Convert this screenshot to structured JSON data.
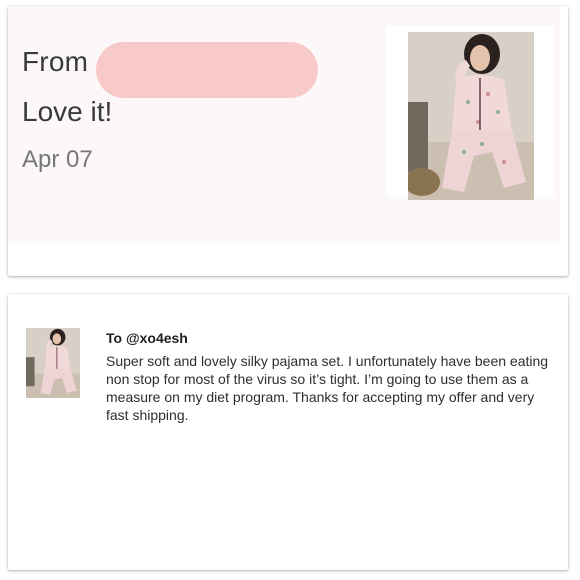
{
  "review": {
    "from_label": "From",
    "title": "Love it!",
    "date": "Apr 07"
  },
  "message": {
    "to": "To @xo4esh",
    "body": "Super soft and lovely silky pajama set. I unfortunately have been eating non stop for most of the virus so it’s tight. I’m going to use them as a measure on my diet program. Thanks for accepting my offer and very fast shipping."
  },
  "colors": {
    "redaction": "#f8c9c9",
    "card_background": "#fcf8f9"
  },
  "icons": {
    "product_photo": "pajama-photo"
  }
}
